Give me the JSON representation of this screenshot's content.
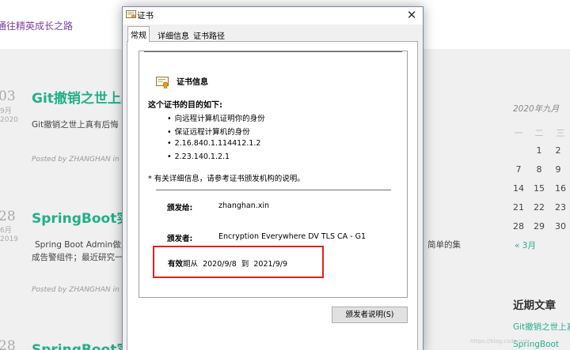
{
  "blog": {
    "tagline": "通往精英成长之路",
    "posts": [
      {
        "day": "03",
        "month": "9月",
        "year": "2020",
        "title": "Git撤销之世上真",
        "excerpt": "Git撤销之世上真有后悔",
        "meta": "Posted by ZHANGHAN in 技"
      },
      {
        "day": "28",
        "month": "6月",
        "year": "2019",
        "title": "SpringBoot实",
        "excerpt": "Spring Boot Admin做为",
        "excerpt_tail": "简单的集",
        "excerpt2": "成告警组件；最近研究一",
        "meta": "Posted by ZHANGHAN in S"
      },
      {
        "day": "28",
        "title": "SpringBoot实"
      }
    ]
  },
  "sidebar": {
    "calendar_title": "2020年九月",
    "weekday_heads": [
      "一",
      "二",
      "三"
    ],
    "rows": [
      [
        "",
        "1",
        "2"
      ],
      [
        "7",
        "8",
        "9"
      ],
      [
        "14",
        "15",
        "16"
      ],
      [
        "21",
        "22",
        "23"
      ],
      [
        "28",
        "29",
        "30"
      ]
    ],
    "prev_link": "« 3月",
    "recent_title": "近期文章",
    "recent_items": [
      "Git撤销之世上真",
      "SpringBoot"
    ]
  },
  "watermark": "https://blog.csdn.net/...",
  "dialog": {
    "title": "证书",
    "close_glyph": "✕",
    "tabs": [
      "常规",
      "详细信息",
      "证书路径"
    ],
    "active_tab": 0,
    "info_title": "证书信息",
    "purpose_heading": "这个证书的目的如下:",
    "purposes": [
      "向远程计算机证明你的身份",
      "保证远程计算机的身份",
      "2.16.840.1.114412.1.2",
      "2.23.140.1.2.1"
    ],
    "note": "* 有关详细信息，请参考证书颁发机构的说明。",
    "issued_to_label": "颁发给:",
    "issued_to": "zhanghan.xin",
    "issued_by_label": "颁发者:",
    "issued_by": "Encryption Everywhere DV TLS CA - G1",
    "valid_label": "有效",
    "valid_from_word": "期从",
    "valid_from": "2020/9/8",
    "valid_to_word": "到",
    "valid_to": "2021/9/9",
    "issuer_button": "颁发者说明(S)"
  },
  "colors": {
    "accent": "#22b089",
    "highlight": "#e02020",
    "tagline": "#7b3fa0"
  }
}
